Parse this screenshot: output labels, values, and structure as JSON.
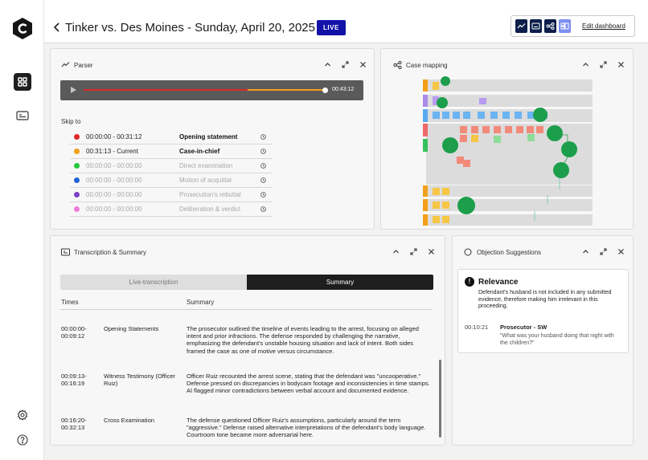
{
  "app": {
    "header": {
      "title": "Tinker vs. Des Moines - Sunday, April 20, 2025",
      "live_badge": "LIVE",
      "edit_dashboard": "Edit dashboard"
    }
  },
  "parser": {
    "title": "Parser",
    "audio": {
      "time": "00:43:12",
      "progress_played": 0.68,
      "progress_buffered": 1.0
    },
    "skip_label": "Skip to",
    "segments": [
      {
        "range": "00:00:00 - 00:31:12",
        "label": "Opening statement",
        "color": "#e0262a",
        "state": "on"
      },
      {
        "range": "00:31:13  - Current",
        "label": "Case-in-chief",
        "color": "#f2a01b",
        "state": "on"
      },
      {
        "range": "00:00:00 - 00:00:00",
        "label": "Direct examination",
        "color": "#22c93a",
        "state": "off"
      },
      {
        "range": "00:00:00 - 00:00:00",
        "label": "Motion of acquittal",
        "color": "#1f63d6",
        "state": "off"
      },
      {
        "range": "00:00:00 - 00:00:00",
        "label": "Prosecution's rebuttal",
        "color": "#7a3fc4",
        "state": "off"
      },
      {
        "range": "00:00:00 - 00:00:00",
        "label": "Deliberation & verdict",
        "color": "#f07ad8",
        "state": "off"
      }
    ]
  },
  "case_mapping": {
    "title": "Case mapping"
  },
  "transcription": {
    "title": "Transcription & Summary",
    "tabs": [
      "Live-transcription",
      "Summary"
    ],
    "columns": {
      "times": "Times",
      "summary": "Summary"
    },
    "rows": [
      {
        "time_start": "00:00:00-",
        "time_end": "00:09:12",
        "topic": "Opening Statements",
        "summary": "The prosecutor outlined the timeline of events leading to the arrest, focusing on alleged intent and prior infractions. The defense responded by challenging the narrative, emphasizing the defendant's unstable housing situation and lack of intent. Both sides framed the case as one of motive versus circumstance."
      },
      {
        "time_start": "00:09:13-",
        "time_end": "00:16:19",
        "topic": "Witness Testimony (Officer Ruiz)",
        "summary": "Officer Ruiz recounted the arrest scene, stating that the defendant was \"uncooperative.\" Defense pressed on discrepancies in bodycam footage and inconsistencies in time stamps. AI flagged minor contradictions between verbal account and documented evidence."
      },
      {
        "time_start": "00:16:20-",
        "time_end": "00:32:13",
        "topic": "Cross Examination",
        "summary": "The defense questioned Officer Ruiz's assumptions, particularly around the term \"aggressive.\" Defense raised alternative interpretations of the defendant's body language. Courtroom tone became more adversarial here."
      }
    ]
  },
  "objections": {
    "title": "Objection Suggestions",
    "card": {
      "heading": "Relevance",
      "description": "Defendant's husband is not included in any submitted evidence, therefore making him irrelevant in this proceeding.",
      "timestamp": "00:10:21",
      "speaker": "Prosecutor - SW",
      "quote": "\"What was your husband doing that night with the children?\""
    }
  }
}
